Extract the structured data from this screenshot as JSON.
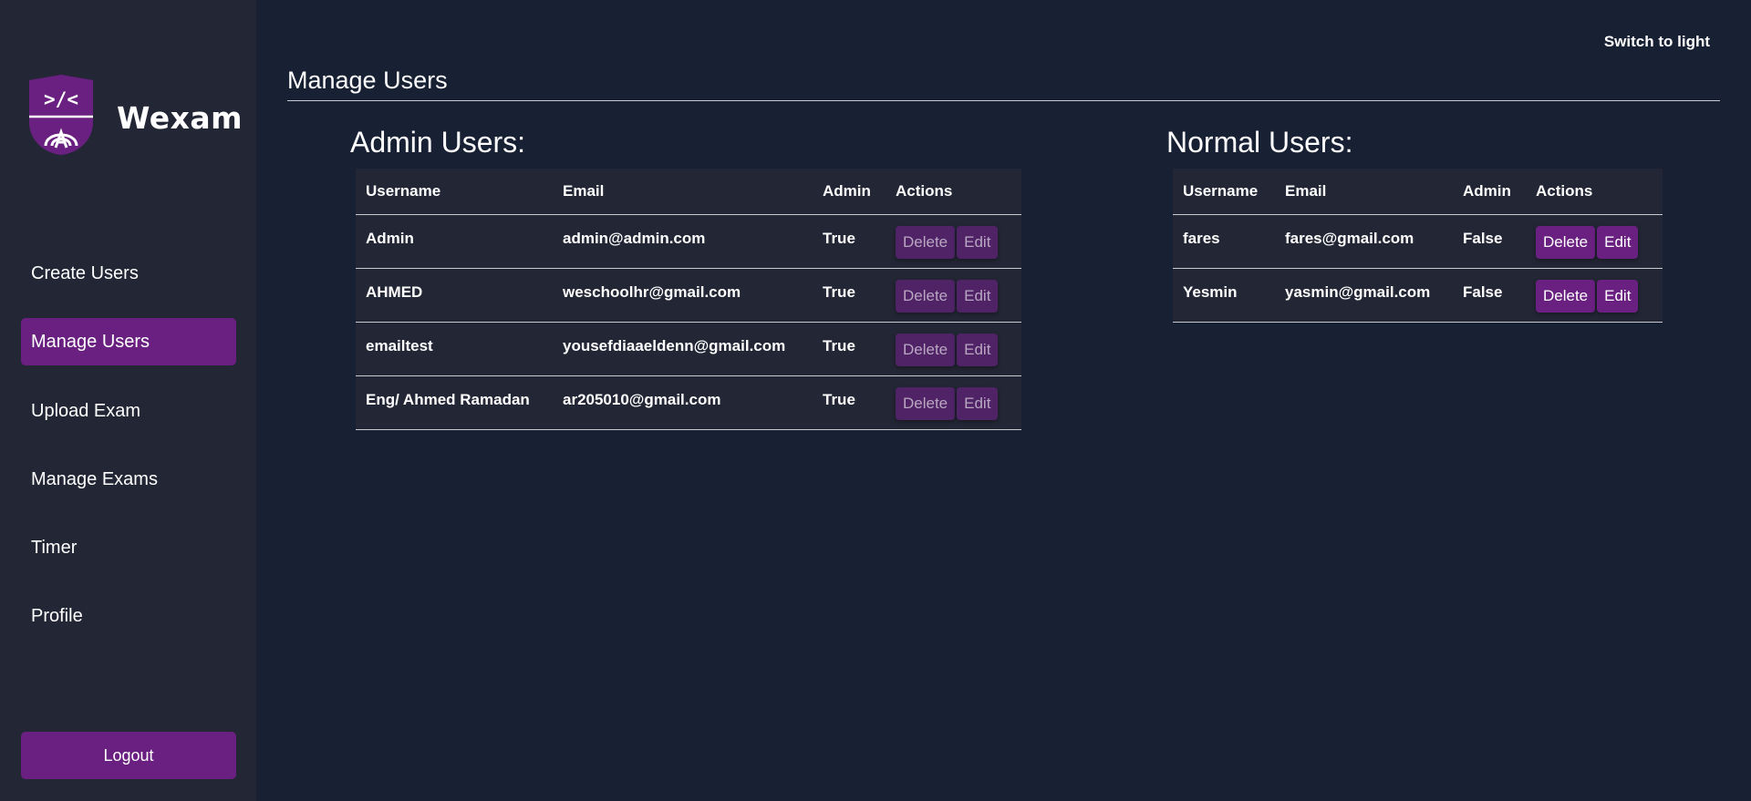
{
  "brand": {
    "name": "Wexam",
    "logo_icon": "wexam-shield-logo",
    "accent": "#6a2080"
  },
  "theme_toggle": "Switch to light",
  "sidebar": {
    "items": [
      {
        "label": "Create Users",
        "active": false
      },
      {
        "label": "Manage Users",
        "active": true
      },
      {
        "label": "Upload Exam",
        "active": false
      },
      {
        "label": "Manage Exams",
        "active": false
      },
      {
        "label": "Timer",
        "active": false
      },
      {
        "label": "Profile",
        "active": false
      }
    ],
    "logout": "Logout"
  },
  "page": {
    "title": "Manage Users"
  },
  "admin": {
    "title": "Admin Users:",
    "headers": [
      "Username",
      "Email",
      "Admin",
      "Actions"
    ],
    "rows": [
      {
        "username": "Admin",
        "email": "admin@admin.com",
        "admin": "True",
        "delete": "Delete",
        "edit": "Edit"
      },
      {
        "username": "AHMED",
        "email": "weschoolhr@gmail.com",
        "admin": "True",
        "delete": "Delete",
        "edit": "Edit"
      },
      {
        "username": "emailtest",
        "email": "yousefdiaaeldenn@gmail.com",
        "admin": "True",
        "delete": "Delete",
        "edit": "Edit"
      },
      {
        "username": "Eng/ Ahmed Ramadan",
        "email": "ar205010@gmail.com",
        "admin": "True",
        "delete": "Delete",
        "edit": "Edit"
      }
    ]
  },
  "normal": {
    "title": "Normal Users:",
    "headers": [
      "Username",
      "Email",
      "Admin",
      "Actions"
    ],
    "rows": [
      {
        "username": "fares",
        "email": "fares@gmail.com",
        "admin": "False",
        "delete": "Delete",
        "edit": "Edit"
      },
      {
        "username": "Yesmin",
        "email": "yasmin@gmail.com",
        "admin": "False",
        "delete": "Delete",
        "edit": "Edit"
      }
    ]
  }
}
